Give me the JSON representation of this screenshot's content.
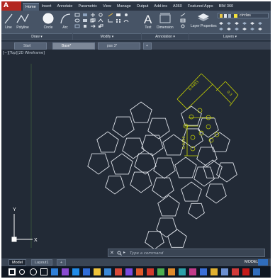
{
  "ribbon": {
    "logo": "A",
    "tabs": [
      "Home",
      "Insert",
      "Annotate",
      "Parametric",
      "View",
      "Manage",
      "Output",
      "Add-ins",
      "A360",
      "Featured Apps",
      "BIM 360"
    ],
    "active_tab": "Home",
    "draw_tools": {
      "line": "Line",
      "polyline": "Polyline",
      "circle": "Circle",
      "arc": "Arc"
    },
    "annotation_tools": {
      "text": "Text",
      "dimension": "Dimension"
    },
    "layer_tools": {
      "layer_properties": "Layer Properties"
    },
    "panels": {
      "draw": "Draw ▾",
      "modify": "Modify ▾",
      "annotation": "Annotation ▾",
      "layers": "Layers ▾"
    },
    "layer_current": "circles"
  },
  "file_tabs": [
    {
      "label": "Start",
      "active": false
    },
    {
      "label": "Base*",
      "active": true
    },
    {
      "label": "pas 3*",
      "active": false
    }
  ],
  "canvas": {
    "view_label": "[−][Top][2D Wireframe]",
    "dimensions": [
      "0.4493",
      "0.3",
      "0.2453"
    ],
    "colors": {
      "background": "#222a36",
      "geometry": "#dfe3ea",
      "dimension": "#c8d400",
      "ucs": "#ffffff"
    },
    "ucs_labels": {
      "x": "X",
      "y": "Y"
    }
  },
  "command_line": {
    "close_label": "✕",
    "placeholder": "Type a command"
  },
  "layout_tabs": [
    {
      "label": "Model",
      "active": true
    },
    {
      "label": "Layout1",
      "active": false
    },
    {
      "label": "+",
      "active": false
    }
  ],
  "status": {
    "model": "MODEL"
  },
  "taskbar": {
    "icons": [
      "windows-icon",
      "search-icon",
      "cortana-icon",
      "task-view-icon",
      "store-icon",
      "media-icon",
      "edge-icon",
      "ie-icon",
      "file-explorer-icon",
      "mail-icon",
      "app-icon",
      "app-icon",
      "app-icon",
      "app-icon",
      "app-icon",
      "app-icon",
      "app-icon",
      "app-icon",
      "app-icon",
      "app-icon",
      "app-icon",
      "app-icon",
      "autocad-icon",
      "app-icon"
    ]
  }
}
